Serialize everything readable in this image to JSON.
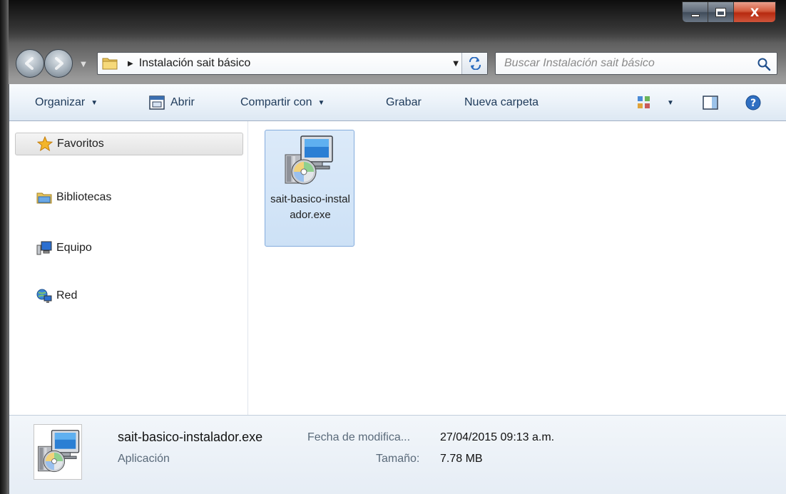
{
  "window": {
    "close_label": "X"
  },
  "address_bar": {
    "path_segment": "Instalación sait básico",
    "folder_icon": "folder-icon",
    "refresh_icon": "refresh-icon"
  },
  "search": {
    "placeholder": "Buscar Instalación sait básico",
    "icon": "search-icon"
  },
  "toolbar": {
    "organize": "Organizar",
    "open": "Abrir",
    "share": "Compartir con",
    "burn": "Grabar",
    "new_folder": "Nueva carpeta"
  },
  "navigation": {
    "favorites": "Favoritos",
    "libraries": "Bibliotecas",
    "computer": "Equipo",
    "network": "Red"
  },
  "files": [
    {
      "name": "sait-basico-instalador.exe",
      "icon": "installer-icon",
      "selected": true
    }
  ],
  "details": {
    "file_name": "sait-basico-instalador.exe",
    "file_type": "Aplicación",
    "modified_label": "Fecha de modifica...",
    "modified_value": "27/04/2015 09:13 a.m.",
    "size_label": "Tamaño:",
    "size_value": "7.78 MB"
  },
  "colors": {
    "selection_fill": "#cde1f6",
    "selection_border": "#84acdd",
    "command_text": "#1e3a5a",
    "close_button": "#c8452b"
  }
}
